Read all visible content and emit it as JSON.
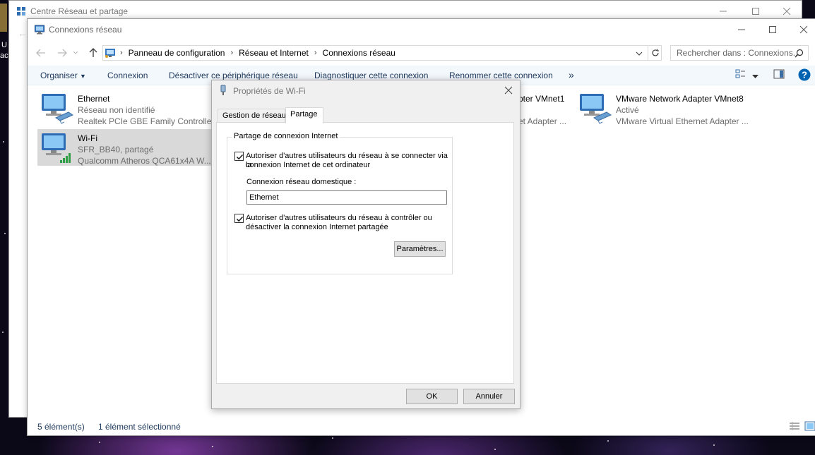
{
  "back_window": {
    "title": "Centre Réseau et partage"
  },
  "desktop_strip": {
    "label1": "U",
    "label2": "ac"
  },
  "main_window": {
    "title": "Connexions réseau",
    "breadcrumb": [
      "Panneau de configuration",
      "Réseau et Internet",
      "Connexions réseau"
    ],
    "search_placeholder": "Rechercher dans : Connexions..."
  },
  "toolbar": {
    "organize": "Organiser",
    "connexion": "Connexion",
    "disable": "Désactiver ce périphérique réseau",
    "diagnose": "Diagnostiquer cette connexion",
    "rename": "Renommer cette connexion",
    "more": "»"
  },
  "connections": [
    {
      "name": "Ethernet",
      "status": "Réseau non identifié",
      "device": "Realtek PCIe GBE Family Controller"
    },
    {
      "name": "Wi-Fi",
      "status": "SFR_BB40, partagé",
      "device": "Qualcomm Atheros QCA61x4A W..."
    },
    {
      "name": "pter VMnet1",
      "status": "",
      "device": "et Adapter ..."
    },
    {
      "name": "VMware Network Adapter VMnet8",
      "status": "Activé",
      "device": "VMware Virtual Ethernet Adapter ..."
    }
  ],
  "statusbar": {
    "count": "5 élément(s)",
    "selected": "1 élément sélectionné"
  },
  "dialog": {
    "title": "Propriétés de Wi-Fi",
    "tabs": [
      "Gestion de réseau",
      "Partage"
    ],
    "active_tab": "Partage",
    "group_title": "Partage de connexion Internet",
    "allow_connect_checked": true,
    "allow_connect_line1": "Autoriser d'autres utilisateurs du réseau à se connecter via la",
    "allow_connect_line2": "connexion Internet de cet ordinateur",
    "home_connection_label": "Connexion réseau domestique :",
    "home_connection_value": "Ethernet",
    "allow_control_checked": true,
    "allow_control_line1": "Autoriser d'autres utilisateurs du réseau à contrôler ou",
    "allow_control_line2": "désactiver la connexion Internet partagée",
    "settings_button": "Paramètres...",
    "ok_button": "OK",
    "cancel_button": "Annuler"
  },
  "colors": {
    "toolbar_text": "#1e395b",
    "selection": "#d9d9d9",
    "help_blue": "#0063b1"
  }
}
